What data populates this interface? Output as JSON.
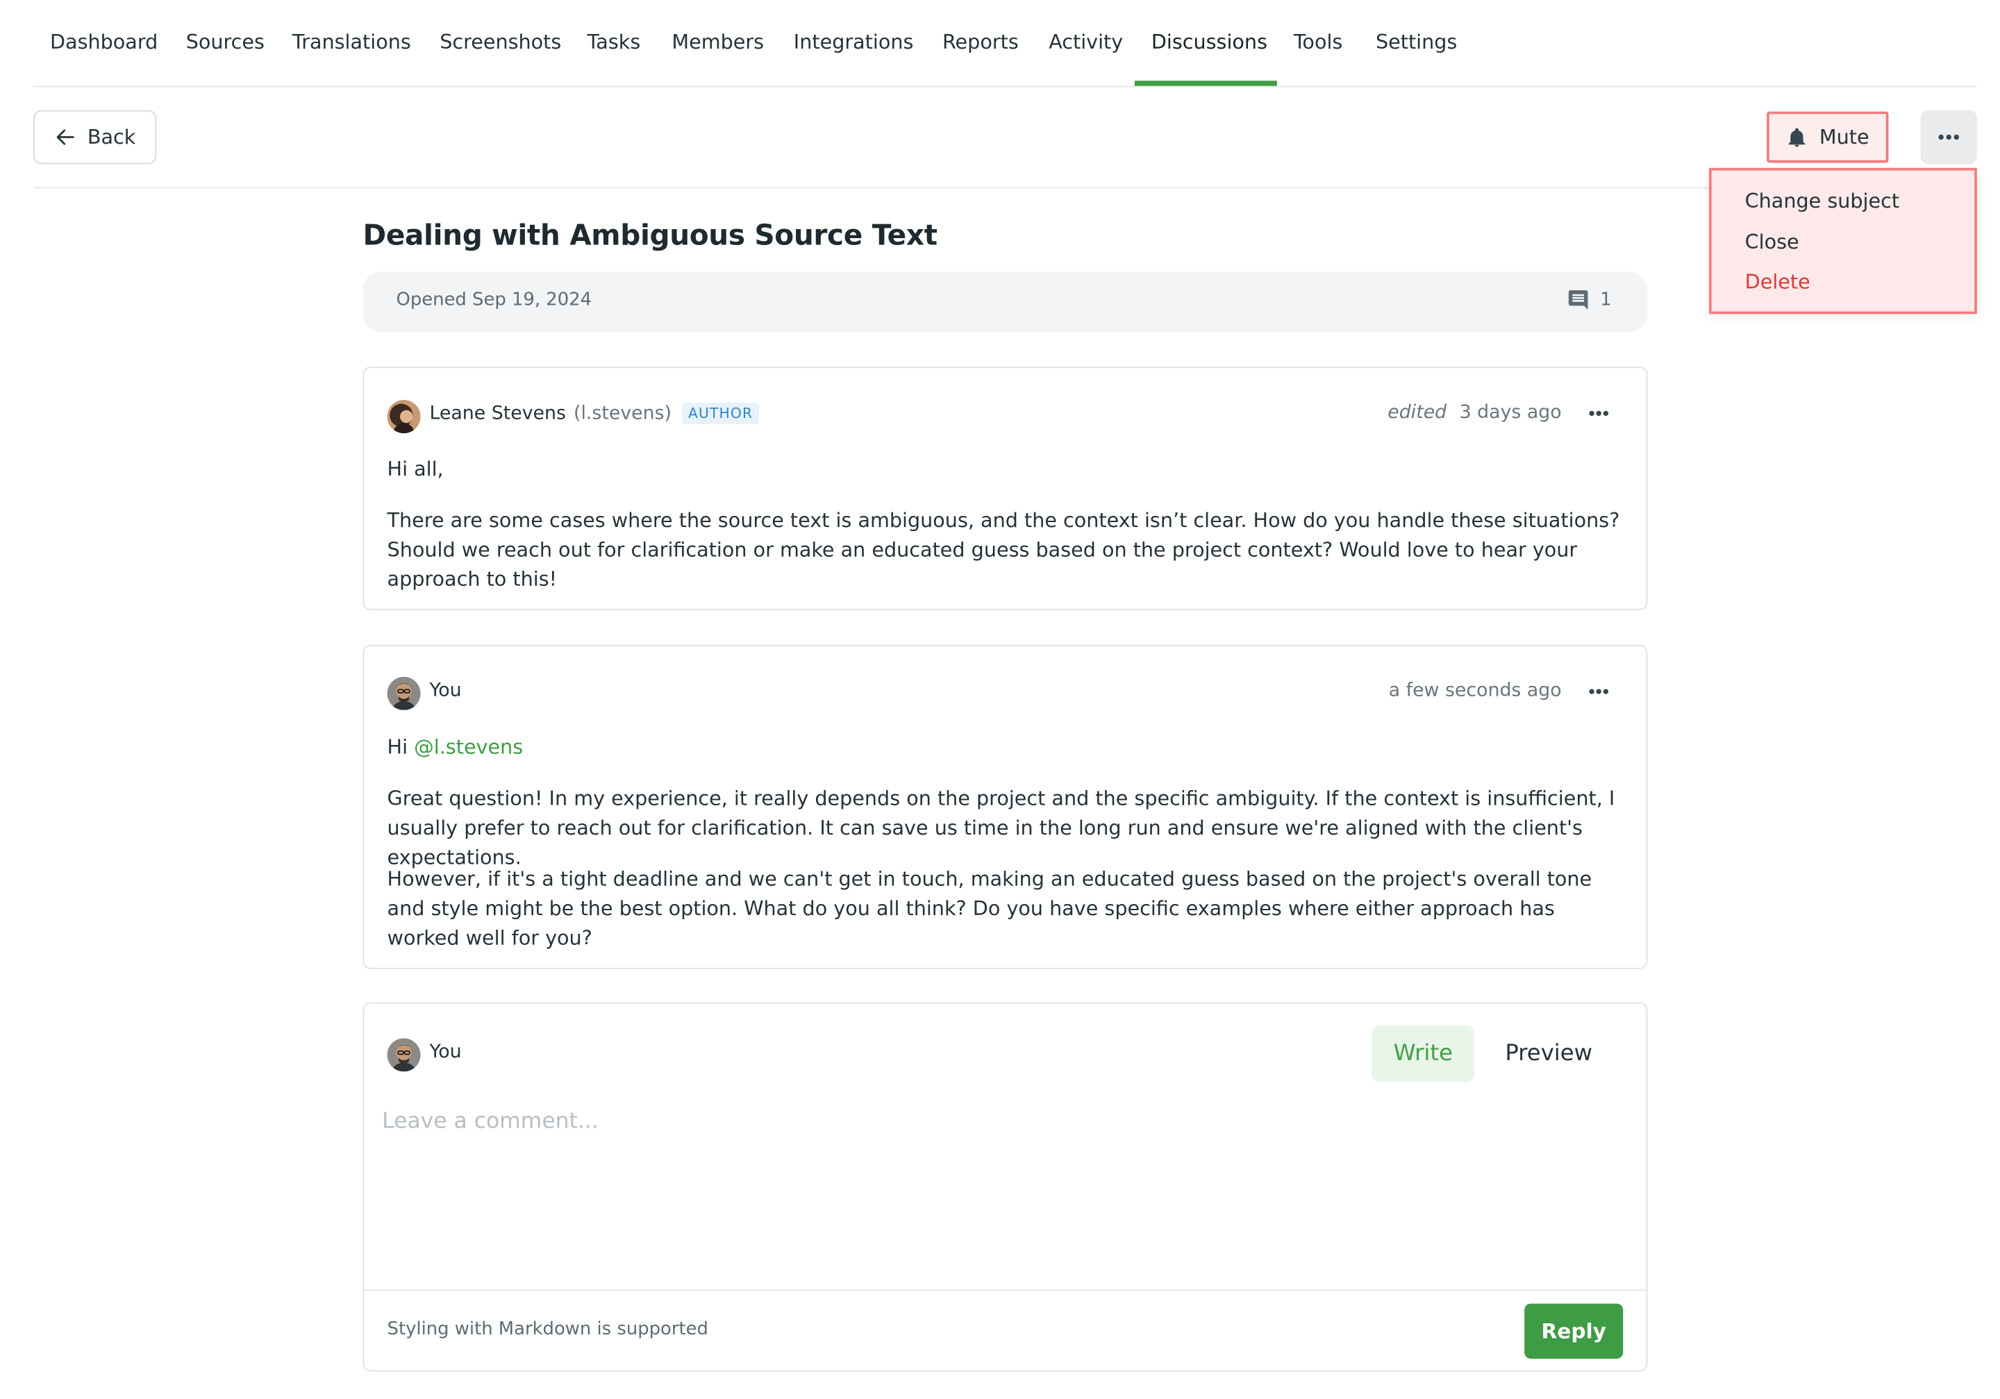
{
  "nav": {
    "items": [
      {
        "label": "Dashboard"
      },
      {
        "label": "Sources"
      },
      {
        "label": "Translations"
      },
      {
        "label": "Screenshots"
      },
      {
        "label": "Tasks"
      },
      {
        "label": "Members"
      },
      {
        "label": "Integrations"
      },
      {
        "label": "Reports"
      },
      {
        "label": "Activity"
      },
      {
        "label": "Discussions"
      },
      {
        "label": "Tools"
      },
      {
        "label": "Settings"
      }
    ],
    "active": "Discussions"
  },
  "toolbar": {
    "back_label": "Back",
    "mute_label": "Mute",
    "more_icon": "more-horizontal-icon"
  },
  "dropdown": {
    "items": [
      {
        "label": "Change subject"
      },
      {
        "label": "Close"
      },
      {
        "label": "Delete",
        "danger": true
      }
    ]
  },
  "discussion": {
    "title": "Dealing with Ambiguous Source Text",
    "opened": "Opened Sep 19, 2024",
    "comment_count": "1"
  },
  "comments": [
    {
      "author": "Leane Stevens",
      "handle": "(l.stevens)",
      "badge": "AUTHOR",
      "edited": "edited",
      "time": "3 days ago",
      "paragraphs": [
        "Hi all,",
        "There are some cases where the source text is ambiguous, and the context isn’t clear. How do you handle these situations? Should we reach out for clarification or make an educated guess based on the project context? Would love to hear your approach to this!"
      ]
    },
    {
      "author": "You",
      "time": "a few seconds ago",
      "greeting": "Hi",
      "mention": "@l.stevens",
      "paragraphs": [
        "Great question! In my experience, it really depends on the project and the specific ambiguity. If the context is insufficient, I usually prefer to reach out for clarification. It can save us time in the long run and ensure we're aligned with the client's expectations.",
        "However, if it's a tight deadline and we can't get in touch, making an educated guess based on the project's overall tone and style might be the best option. What do you all think? Do you have specific examples where either approach has worked well for you?"
      ]
    }
  ],
  "composer": {
    "author": "You",
    "tab_write": "Write",
    "tab_preview": "Preview",
    "placeholder": "Leave a comment...",
    "value": "",
    "markdown_note": "Styling with Markdown is supported",
    "reply_label": "Reply"
  },
  "colors": {
    "accent": "#3c9d43",
    "danger": "#d93b34",
    "badge": "#2f86c9",
    "highlight_border": "#f17c7c"
  }
}
